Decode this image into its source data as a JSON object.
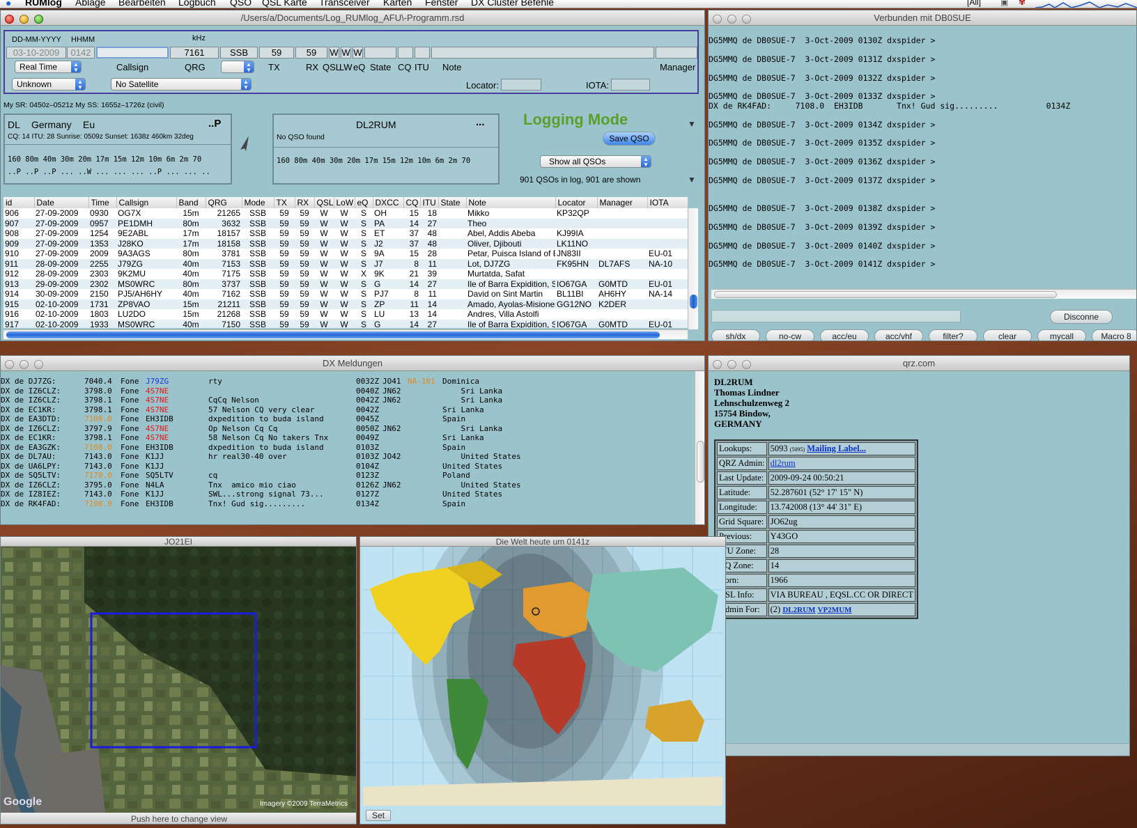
{
  "menubar": {
    "app": "RUMlog",
    "items": [
      "Ablage",
      "Bearbeiten",
      "Logbuch",
      "QSO",
      "QSL Karte",
      "Transceiver",
      "Karten",
      "Fenster",
      "DX Cluster Befehle"
    ],
    "tray": "[All]"
  },
  "log_window": {
    "title": "/Users/a/Documents/Log_RUMlog_AFU\\-Programm.rsd",
    "entry": {
      "date_label": "DD-MM-YYYY",
      "time_label": "HHMM",
      "khz_label": "kHz",
      "date": "03-10-2009",
      "time": "0142",
      "callsign": "",
      "qrg": "7161",
      "mode": "SSB",
      "tx": "59",
      "rx": "59",
      "qsl": "W",
      "lw": "W",
      "eq": "W",
      "timing_select": "Real Time",
      "callsign_label": "Callsign",
      "qrg_label": "QRG",
      "tx_label": "TX",
      "rx_label": "RX",
      "qsl_label": "QSL",
      "lw_label": "LW",
      "eq_label": "eQ",
      "state_label": "State",
      "cq_label": "CQ",
      "itu_label": "ITU",
      "note_label": "Note",
      "manager_label": "Manager",
      "propagation_select": "Unknown",
      "satellite_select": "No Satellite",
      "locator_label": "Locator:",
      "iota_label": "IOTA:"
    },
    "sun_info": "My SR: 0450z–0521z   My SS: 1655z–1726z (civil)",
    "country_panel": {
      "prefix": "DL",
      "country": "Germany",
      "continent": "Eu",
      "flag": "..P",
      "details": "CQ: 14   ITU: 28  Sunrise: 0509z  Sunset: 1638z  460km  32deg",
      "bands": "160  80m  40m  30m  20m  17m  15m  12m  10m   6m   2m  70",
      "status": "..P ..P ..P ... ..W ... ... ... ..P ... ... .."
    },
    "call_panel": {
      "call": "DL2RUM",
      "more": "...",
      "result": "No QSO found",
      "bands": "160  80m  40m  30m  20m  17m  15m  12m  10m   6m   2m  70"
    },
    "mode_title": "Logging Mode",
    "save_button": "Save QSO",
    "show_select": "Show all QSOs",
    "qso_count": "901 QSOs in log, 901 are shown",
    "table": {
      "columns": [
        "id",
        "Date",
        "Time",
        "Callsign",
        "Band",
        "QRG",
        "Mode",
        "TX",
        "RX",
        "QSL",
        "LoW",
        "eQ",
        "DXCC",
        "CQ",
        "ITU",
        "State",
        "Note",
        "Locator",
        "Manager",
        "IOTA"
      ],
      "rows": [
        [
          "906",
          "27-09-2009",
          "0930",
          "OG7X",
          "15m",
          "21265",
          "SSB",
          "59",
          "59",
          "W",
          "W",
          "S",
          "OH",
          "15",
          "18",
          "",
          "Mikko",
          "KP32QP",
          "",
          ""
        ],
        [
          "907",
          "27-09-2009",
          "0957",
          "PE1DMH",
          "80m",
          "3632",
          "SSB",
          "59",
          "59",
          "W",
          "W",
          "S",
          "PA",
          "14",
          "27",
          "",
          "Theo",
          "",
          "",
          ""
        ],
        [
          "908",
          "27-09-2009",
          "1254",
          "9E2ABL",
          "17m",
          "18157",
          "SSB",
          "59",
          "59",
          "W",
          "W",
          "S",
          "ET",
          "37",
          "48",
          "",
          "Abel, Addis Abeba",
          "KJ99IA",
          "",
          ""
        ],
        [
          "909",
          "27-09-2009",
          "1353",
          "J28KO",
          "17m",
          "18158",
          "SSB",
          "59",
          "59",
          "W",
          "W",
          "S",
          "J2",
          "37",
          "48",
          "",
          "Oliver, Djibouti",
          "LK11NO",
          "",
          ""
        ],
        [
          "910",
          "27-09-2009",
          "2009",
          "9A3AGS",
          "80m",
          "3781",
          "SSB",
          "59",
          "59",
          "W",
          "W",
          "S",
          "9A",
          "15",
          "28",
          "",
          "Petar, Puisca Island of Brac",
          "JN83II",
          "",
          "EU-01"
        ],
        [
          "911",
          "28-09-2009",
          "2255",
          "J79ZG",
          "40m",
          "7153",
          "SSB",
          "59",
          "59",
          "W",
          "W",
          "S",
          "J7",
          "8",
          "11",
          "",
          "Lot, DJ7ZG",
          "FK95HN",
          "DL7AFS",
          "NA-10"
        ],
        [
          "912",
          "28-09-2009",
          "2303",
          "9K2MU",
          "40m",
          "7175",
          "SSB",
          "59",
          "59",
          "W",
          "W",
          "X",
          "9K",
          "21",
          "39",
          "",
          "Murtatda, Safat",
          "",
          "",
          ""
        ],
        [
          "913",
          "29-09-2009",
          "2302",
          "MS0WRC",
          "80m",
          "3737",
          "SSB",
          "59",
          "59",
          "W",
          "W",
          "S",
          "G",
          "14",
          "27",
          "",
          "Ile of Barra Expidition, S...",
          "IO67GA",
          "G0MTD",
          "EU-01"
        ],
        [
          "914",
          "30-09-2009",
          "2150",
          "PJ5/AH6HY",
          "40m",
          "7162",
          "SSB",
          "59",
          "59",
          "W",
          "W",
          "S",
          "PJ7",
          "8",
          "11",
          "",
          "David on Sint Martin",
          "BL11BI",
          "AH6HY",
          "NA-14"
        ],
        [
          "915",
          "02-10-2009",
          "1731",
          "ZP8VAO",
          "15m",
          "21211",
          "SSB",
          "59",
          "59",
          "W",
          "W",
          "S",
          "ZP",
          "11",
          "14",
          "",
          "Amado, Ayolas-Misiones",
          "GG12NO",
          "K2DER",
          ""
        ],
        [
          "916",
          "02-10-2009",
          "1803",
          "LU2DO",
          "15m",
          "21268",
          "SSB",
          "59",
          "59",
          "W",
          "W",
          "S",
          "LU",
          "13",
          "14",
          "",
          "Andres, Villa Astolfi",
          "",
          "",
          ""
        ],
        [
          "917",
          "02-10-2009",
          "1933",
          "MS0WRC",
          "40m",
          "7150",
          "SSB",
          "59",
          "59",
          "W",
          "W",
          "S",
          "G",
          "14",
          "27",
          "",
          "Ile of Barra Expidition, S...",
          "IO67GA",
          "G0MTD",
          "EU-01"
        ]
      ]
    }
  },
  "cluster_window": {
    "title": "Verbunden mit DB0SUE",
    "lines": [
      "DG5MMQ de DB0SUE-7  3-Oct-2009 0130Z dxspider >",
      "",
      "DG5MMQ de DB0SUE-7  3-Oct-2009 0131Z dxspider >",
      "",
      "DG5MMQ de DB0SUE-7  3-Oct-2009 0132Z dxspider >",
      "",
      "DG5MMQ de DB0SUE-7  3-Oct-2009 0133Z dxspider >",
      "DX de RK4FAD:     7108.0  EH3IDB       Tnx! Gud sig.........          0134Z",
      "",
      "DG5MMQ de DB0SUE-7  3-Oct-2009 0134Z dxspider >",
      "",
      "DG5MMQ de DB0SUE-7  3-Oct-2009 0135Z dxspider >",
      "",
      "DG5MMQ de DB0SUE-7  3-Oct-2009 0136Z dxspider >",
      "",
      "DG5MMQ de DB0SUE-7  3-Oct-2009 0137Z dxspider >",
      "",
      "",
      "DG5MMQ de DB0SUE-7  3-Oct-2009 0138Z dxspider >",
      "",
      "DG5MMQ de DB0SUE-7  3-Oct-2009 0139Z dxspider >",
      "",
      "DG5MMQ de DB0SUE-7  3-Oct-2009 0140Z dxspider >",
      "",
      "DG5MMQ de DB0SUE-7  3-Oct-2009 0141Z dxspider >"
    ],
    "disconnect": "Disconne",
    "macros": [
      "sh/dx",
      "no-cw",
      "acc/eu",
      "acc/vhf",
      "filter?",
      "clear",
      "mycall",
      "Macro 8"
    ]
  },
  "dx_window": {
    "title": "DX Meldungen",
    "rows": [
      {
        "head": "DX de DJ7ZG:",
        "freq": "7040.4",
        "mode": "Fone",
        "call": "J79ZG",
        "call_color": "#1438d8",
        "freq_color": "#000000",
        "comment": "rty",
        "time": "0032Z",
        "loc": "JO41",
        "iota": "NA-101",
        "country": "Dominica"
      },
      {
        "head": "DX de IZ6CLZ:",
        "freq": "3798.0",
        "mode": "Fone",
        "call": "4S7NE",
        "call_color": "#e01818",
        "freq_color": "#000000",
        "comment": "",
        "time": "0040Z",
        "loc": "JN62",
        "iota": "",
        "country": "    Sri Lanka"
      },
      {
        "head": "DX de IZ6CLZ:",
        "freq": "3798.1",
        "mode": "Fone",
        "call": "4S7NE",
        "call_color": "#e01818",
        "freq_color": "#000000",
        "comment": "CqCq Nelson",
        "time": "0042Z",
        "loc": "JN62",
        "iota": "",
        "country": "    Sri Lanka"
      },
      {
        "head": "DX de EC1KR:",
        "freq": "3798.1",
        "mode": "Fone",
        "call": "4S7NE",
        "call_color": "#e01818",
        "freq_color": "#000000",
        "comment": "57 Nelson CQ very clear",
        "time": "0042Z",
        "loc": "",
        "iota": "",
        "country": "Sri Lanka"
      },
      {
        "head": "DX de EA3DTD:",
        "freq": "7108.0",
        "mode": "Fone",
        "call": "EH3IDB",
        "call_color": "#000000",
        "freq_color": "#e08a1e",
        "comment": "dxpedition to buda island",
        "time": "0045Z",
        "loc": "",
        "iota": "",
        "country": "Spain"
      },
      {
        "head": "DX de IZ6CLZ:",
        "freq": "3797.9",
        "mode": "Fone",
        "call": "4S7NE",
        "call_color": "#e01818",
        "freq_color": "#000000",
        "comment": "Op Nelson Cq Cq",
        "time": "0050Z",
        "loc": "JN62",
        "iota": "",
        "country": "    Sri Lanka"
      },
      {
        "head": "DX de EC1KR:",
        "freq": "3798.1",
        "mode": "Fone",
        "call": "4S7NE",
        "call_color": "#e01818",
        "freq_color": "#000000",
        "comment": "58 Nelson Cq No takers Tnx",
        "time": "0049Z",
        "loc": "",
        "iota": "",
        "country": "Sri Lanka"
      },
      {
        "head": "DX de EA3GZK:",
        "freq": "7108.0",
        "mode": "Fone",
        "call": "EH3IDB",
        "call_color": "#000000",
        "freq_color": "#e08a1e",
        "comment": "dxpedition to buda island",
        "time": "0103Z",
        "loc": "",
        "iota": "",
        "country": "Spain"
      },
      {
        "head": "DX de DL7AU:",
        "freq": "7143.0",
        "mode": "Fone",
        "call": "K1JJ",
        "call_color": "#000000",
        "freq_color": "#000000",
        "comment": "hr real30-40 over",
        "time": "0103Z",
        "loc": "JO42",
        "iota": "",
        "country": "    United States"
      },
      {
        "head": "DX de UA6LPY:",
        "freq": "7143.0",
        "mode": "Fone",
        "call": "K1JJ",
        "call_color": "#000000",
        "freq_color": "#000000",
        "comment": "",
        "time": "0104Z",
        "loc": "",
        "iota": "",
        "country": "United States"
      },
      {
        "head": "DX de SQ5LTV:",
        "freq": "7170.0",
        "mode": "Fone",
        "call": "SQ5LTV",
        "call_color": "#000000",
        "freq_color": "#e08a1e",
        "comment": "cq",
        "time": "0123Z",
        "loc": "",
        "iota": "",
        "country": "Poland"
      },
      {
        "head": "DX de IZ6CLZ:",
        "freq": "3795.0",
        "mode": "Fone",
        "call": "N4LA",
        "call_color": "#000000",
        "freq_color": "#000000",
        "comment": "Tnx  amico mio ciao",
        "time": "0126Z",
        "loc": "JN62",
        "iota": "",
        "country": "    United States"
      },
      {
        "head": "DX de IZ8IEZ:",
        "freq": "7143.0",
        "mode": "Fone",
        "call": "K1JJ",
        "call_color": "#000000",
        "freq_color": "#000000",
        "comment": "SWL...strong signal 73...",
        "time": "0127Z",
        "loc": "",
        "iota": "",
        "country": "United States"
      },
      {
        "head": "DX de RK4FAD:",
        "freq": "7108.0",
        "mode": "Fone",
        "call": "EH3IDB",
        "call_color": "#000000",
        "freq_color": "#e08a1e",
        "comment": "Tnx! Gud sig.........",
        "time": "0134Z",
        "loc": "",
        "iota": "",
        "country": "Spain"
      }
    ]
  },
  "qrz_window": {
    "title": "qrz.com",
    "address": [
      "DL2RUM",
      "Thomas Lindner",
      "Lehnschulzenweg 2",
      "15754 Bindow,",
      "GERMANY"
    ],
    "lookups_label": "Lookups:",
    "lookups_value": "5093",
    "lookups_small": "(5095)",
    "mailing_link": "Mailing Label...",
    "admin_label": "QRZ Admin:",
    "admin_link": "dl2rum",
    "fields": [
      {
        "label": "Last Update:",
        "value": "2009-09-24 00:50:21"
      },
      {
        "label": "Latitude:",
        "value": "52.287601 (52° 17' 15\" N)"
      },
      {
        "label": "Longitude:",
        "value": "13.742008 (13° 44' 31\" E)"
      },
      {
        "label": "Grid Square:",
        "value": "JO62ug"
      },
      {
        "label": "Previous:",
        "value": "Y43GO"
      },
      {
        "label": "ITU Zone:",
        "value": "28"
      },
      {
        "label": "CQ Zone:",
        "value": "14"
      },
      {
        "label": "Born:",
        "value": "1966"
      },
      {
        "label": "QSL Info:",
        "value": "VIA BUREAU , EQSL.CC OR DIRECT"
      }
    ],
    "adminfor_label": "Admin For:",
    "adminfor_prefix": "(2)",
    "adminfor_links": [
      "DL2RUM",
      "VP2MUM"
    ]
  },
  "sat_window": {
    "title": "JO21EI",
    "footer": "Push here to change view",
    "credit": "Imagery ©2009 TerraMetrics",
    "logo": "Google"
  },
  "world_window": {
    "title": "Die Welt heute um 0141z",
    "set_button": "Set"
  },
  "colors": {
    "panel": "#9bc3cc",
    "logging_mode": "#5aa02c",
    "link": "#0a32c8"
  }
}
